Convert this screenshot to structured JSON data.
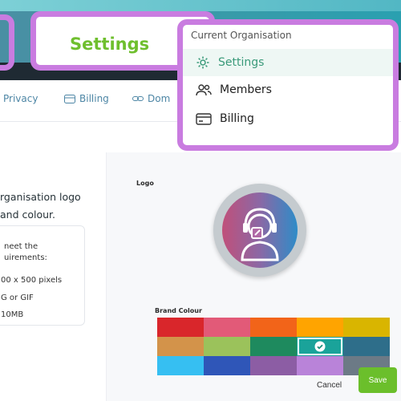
{
  "header": {
    "callout_title": "Settings"
  },
  "nav_tabs": [
    {
      "label": "Privacy",
      "icon": "none"
    },
    {
      "label": "Billing",
      "icon": "card-icon"
    },
    {
      "label": "Dom",
      "icon": "link-icon"
    }
  ],
  "dropdown": {
    "heading": "Current Organisation",
    "items": [
      {
        "label": "Settings",
        "icon": "gear-icon",
        "active": true
      },
      {
        "label": "Members",
        "icon": "users-icon",
        "active": false
      },
      {
        "label": "Billing",
        "icon": "card-icon",
        "active": false
      }
    ]
  },
  "content": {
    "desc_line1": "rganisation logo",
    "desc_line2": "and colour.",
    "requirements": [
      "neet the",
      "uirements:",
      "00 x 500 pixels",
      "G or GIF",
      "10MB"
    ]
  },
  "logo": {
    "label": "Logo"
  },
  "brand": {
    "label": "Brand Colour",
    "selected_index": 8,
    "colors": [
      "#d9262b",
      "#e25a78",
      "#f26419",
      "#ffa400",
      "#d9b500",
      "#d3934a",
      "#9bc25b",
      "#1e8a5e",
      "#1aa39a",
      "#2e6e8a",
      "#36bff2",
      "#2f56b8",
      "#8c5da4",
      "#b983d9",
      "#6c7a86"
    ]
  },
  "actions": {
    "cancel": "Cancel",
    "save": "Save"
  }
}
